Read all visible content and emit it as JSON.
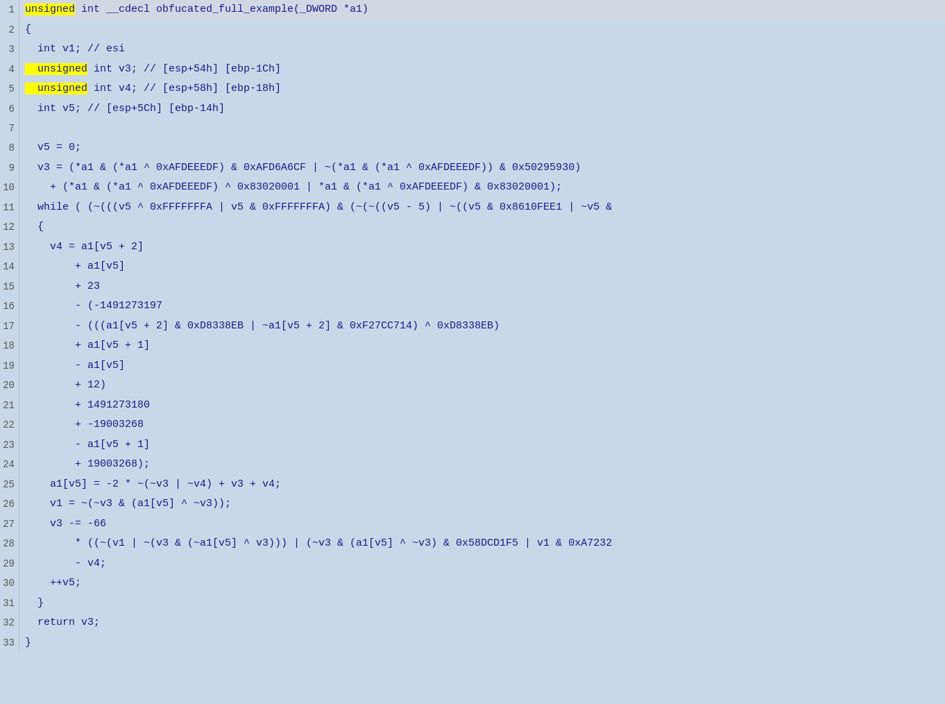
{
  "editor": {
    "lines": [
      {
        "num": 1,
        "tokens": [
          {
            "type": "kw-highlight",
            "text": "unsigned"
          },
          {
            "type": "normal",
            "text": " int __cdecl obfucated_full_example(_DWORD *a1)"
          }
        ],
        "isHeader": true
      },
      {
        "num": 2,
        "tokens": [
          {
            "type": "normal",
            "text": "{"
          }
        ]
      },
      {
        "num": 3,
        "tokens": [
          {
            "type": "normal",
            "text": "  int v1; // esi"
          }
        ]
      },
      {
        "num": 4,
        "tokens": [
          {
            "type": "kw-highlight",
            "text": "  unsigned"
          },
          {
            "type": "normal",
            "text": " int v3; // [esp+54h] [ebp-1Ch]"
          }
        ]
      },
      {
        "num": 5,
        "tokens": [
          {
            "type": "kw-highlight",
            "text": "  unsigned"
          },
          {
            "type": "normal",
            "text": " int v4; // [esp+58h] [ebp-18h]"
          }
        ]
      },
      {
        "num": 6,
        "tokens": [
          {
            "type": "normal",
            "text": "  int v5; // [esp+5Ch] [ebp-14h]"
          }
        ]
      },
      {
        "num": 7,
        "tokens": [
          {
            "type": "normal",
            "text": ""
          }
        ]
      },
      {
        "num": 8,
        "tokens": [
          {
            "type": "normal",
            "text": "  v5 = 0;"
          }
        ]
      },
      {
        "num": 9,
        "tokens": [
          {
            "type": "normal",
            "text": "  v3 = (*a1 & (*a1 ^ 0xAFDEEEDF) & 0xAFD6A6CF | ~(*a1 & (*a1 ^ 0xAFDEEEDF)) & 0x50295930)"
          }
        ]
      },
      {
        "num": 10,
        "tokens": [
          {
            "type": "normal",
            "text": "    + (*a1 & (*a1 ^ 0xAFDEEEDF) ^ 0x83020001 | *a1 & (*a1 ^ 0xAFDEEEDF) & 0x83020001);"
          }
        ]
      },
      {
        "num": 11,
        "tokens": [
          {
            "type": "normal",
            "text": "  while ( (~(((v5 ^ 0xFFFFFFFA | v5 & 0xFFFFFFFA) & (~(~((v5 - 5) | ~((v5 & 0x8610FEE1 | ~v5 &"
          }
        ]
      },
      {
        "num": 12,
        "tokens": [
          {
            "type": "normal",
            "text": "  {"
          }
        ]
      },
      {
        "num": 13,
        "tokens": [
          {
            "type": "normal",
            "text": "    v4 = a1[v5 + 2]"
          }
        ]
      },
      {
        "num": 14,
        "tokens": [
          {
            "type": "normal",
            "text": "        + a1[v5]"
          }
        ]
      },
      {
        "num": 15,
        "tokens": [
          {
            "type": "normal",
            "text": "        + 23"
          }
        ]
      },
      {
        "num": 16,
        "tokens": [
          {
            "type": "normal",
            "text": "        - (-1491273197"
          }
        ]
      },
      {
        "num": 17,
        "tokens": [
          {
            "type": "normal",
            "text": "        - (((a1[v5 + 2] & 0xD8338EB | ~a1[v5 + 2] & 0xF27CC714) ^ 0xD8338EB)"
          }
        ]
      },
      {
        "num": 18,
        "tokens": [
          {
            "type": "normal",
            "text": "        + a1[v5 + 1]"
          }
        ]
      },
      {
        "num": 19,
        "tokens": [
          {
            "type": "normal",
            "text": "        - a1[v5]"
          }
        ]
      },
      {
        "num": 20,
        "tokens": [
          {
            "type": "normal",
            "text": "        + 12)"
          }
        ]
      },
      {
        "num": 21,
        "tokens": [
          {
            "type": "normal",
            "text": "        + 1491273180"
          }
        ]
      },
      {
        "num": 22,
        "tokens": [
          {
            "type": "normal",
            "text": "        + -19003268"
          }
        ]
      },
      {
        "num": 23,
        "tokens": [
          {
            "type": "normal",
            "text": "        - a1[v5 + 1]"
          }
        ]
      },
      {
        "num": 24,
        "tokens": [
          {
            "type": "normal",
            "text": "        + 19003268);"
          }
        ]
      },
      {
        "num": 25,
        "tokens": [
          {
            "type": "normal",
            "text": "    a1[v5] = -2 * ~(~v3 | ~v4) + v3 + v4;"
          }
        ]
      },
      {
        "num": 26,
        "tokens": [
          {
            "type": "normal",
            "text": "    v1 = ~(~v3 & (a1[v5] ^ ~v3));"
          }
        ]
      },
      {
        "num": 27,
        "tokens": [
          {
            "type": "normal",
            "text": "    v3 -= -66"
          }
        ]
      },
      {
        "num": 28,
        "tokens": [
          {
            "type": "normal",
            "text": "        * ((~(v1 | ~(v3 & (~a1[v5] ^ v3))) | (~v3 & (a1[v5] ^ ~v3) & 0x58DCD1F5 | v1 & 0xA7232"
          }
        ]
      },
      {
        "num": 29,
        "tokens": [
          {
            "type": "normal",
            "text": "        - v4;"
          }
        ]
      },
      {
        "num": 30,
        "tokens": [
          {
            "type": "normal",
            "text": "    ++v5;"
          }
        ]
      },
      {
        "num": 31,
        "tokens": [
          {
            "type": "normal",
            "text": "  }"
          }
        ]
      },
      {
        "num": 32,
        "tokens": [
          {
            "type": "normal",
            "text": "  return v3;"
          }
        ]
      },
      {
        "num": 33,
        "tokens": [
          {
            "type": "normal",
            "text": "}"
          }
        ]
      }
    ]
  }
}
